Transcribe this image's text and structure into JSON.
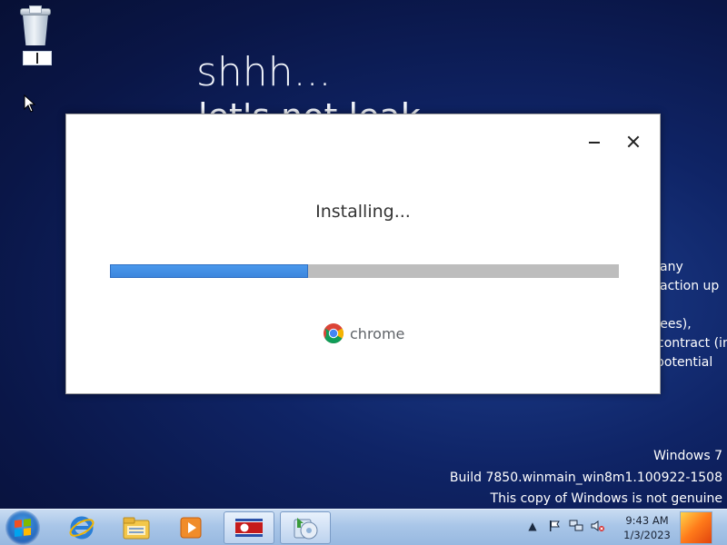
{
  "desktop": {
    "icons": [
      {
        "name": "recycle-bin-icon"
      }
    ],
    "background": {
      "title": "shhh...",
      "subtitle": "let's not leak",
      "side_lines": [
        "any",
        "action up",
        "yees),",
        "contract (in",
        "potential"
      ]
    },
    "watermark": {
      "line1": "Windows 7",
      "line2": "Build 7850.winmain_win8m1.100922-1508",
      "line3": "This copy of Windows is not genuine"
    }
  },
  "installer": {
    "status": "Installing...",
    "progress": 0.39,
    "brand_label": "chrome",
    "colors": {
      "progress_fill": "#3c86dd",
      "progress_track": "#bdbdbd"
    }
  },
  "taskbar": {
    "items": [
      {
        "name": "start-button"
      },
      {
        "name": "internet-explorer-icon"
      },
      {
        "name": "file-explorer-icon"
      },
      {
        "name": "media-player-icon"
      },
      {
        "name": "flag-app-icon"
      },
      {
        "name": "installer-icon"
      }
    ],
    "tray": {
      "icons": [
        "show-hidden-icons-icon",
        "action-center-flag-icon",
        "network-icon",
        "volume-muted-icon"
      ]
    },
    "clock": {
      "time": "9:43 AM",
      "date": "1/3/2023"
    }
  }
}
